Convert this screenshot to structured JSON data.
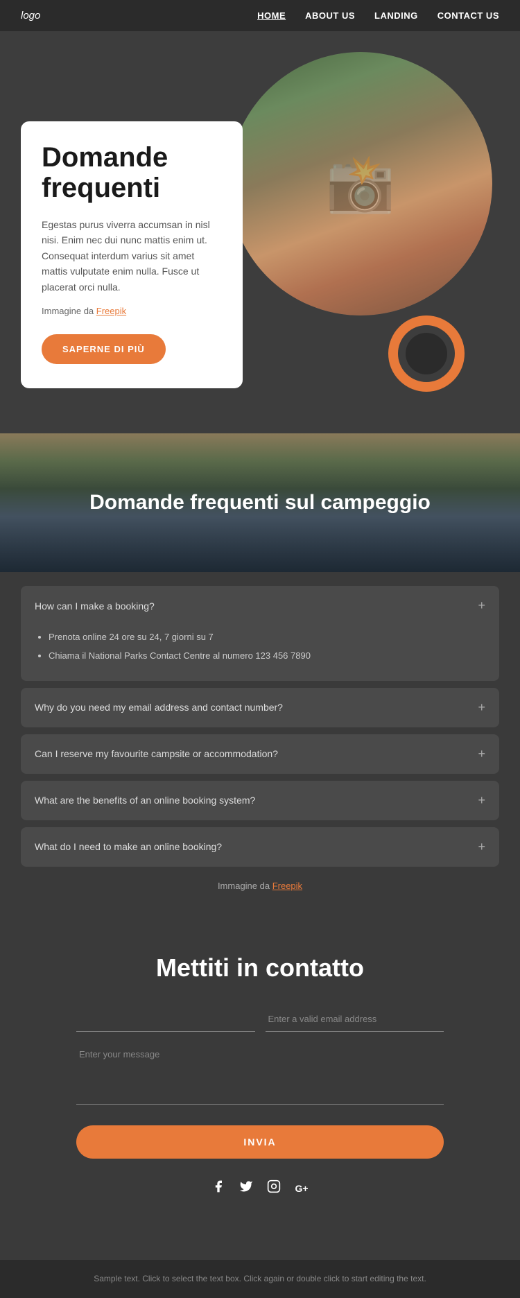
{
  "nav": {
    "logo": "logo",
    "links": [
      {
        "label": "HOME",
        "active": true
      },
      {
        "label": "ABOUT US",
        "active": false
      },
      {
        "label": "LANDING",
        "active": false
      },
      {
        "label": "CONTACT US",
        "active": false
      }
    ]
  },
  "hero": {
    "title_line1": "Domande",
    "title_line2": "frequenti",
    "description": "Egestas purus viverra accumsan in nisl nisi. Enim nec dui nunc mattis enim ut. Consequat interdum varius sit amet mattis vulputate enim nulla. Fusce ut placerat orci nulla.",
    "img_credit_text": "Immagine da ",
    "img_credit_link": "Freepik",
    "button_label": "SAPERNE DI PIÙ"
  },
  "faq_banner": {
    "title": "Domande frequenti sul campeggio"
  },
  "faq": {
    "items": [
      {
        "question": "How can I make a booking?",
        "expanded": true,
        "answer_bullets": [
          "Prenota online 24 ore su 24, 7 giorni su 7",
          "Chiama il National Parks Contact Centre al numero 123 456 7890"
        ]
      },
      {
        "question": "Why do you need my email address and contact number?",
        "expanded": false,
        "answer_bullets": []
      },
      {
        "question": "Can I reserve my favourite campsite or accommodation?",
        "expanded": false,
        "answer_bullets": []
      },
      {
        "question": "What are the benefits of an online booking system?",
        "expanded": false,
        "answer_bullets": []
      },
      {
        "question": "What do I need to make an online booking?",
        "expanded": false,
        "answer_bullets": []
      }
    ],
    "img_credit_text": "Immagine da ",
    "img_credit_link": "Freepik"
  },
  "contact": {
    "title": "Mettiti in contatto",
    "name_placeholder": "",
    "email_placeholder": "Enter a valid email address",
    "message_placeholder": "Enter your message",
    "button_label": "INVIA"
  },
  "social": {
    "icons": [
      "f",
      "🐦",
      "📷",
      "G+"
    ]
  },
  "footer": {
    "text": "Sample text. Click to select the text box. Click again or double click to start editing the text."
  }
}
